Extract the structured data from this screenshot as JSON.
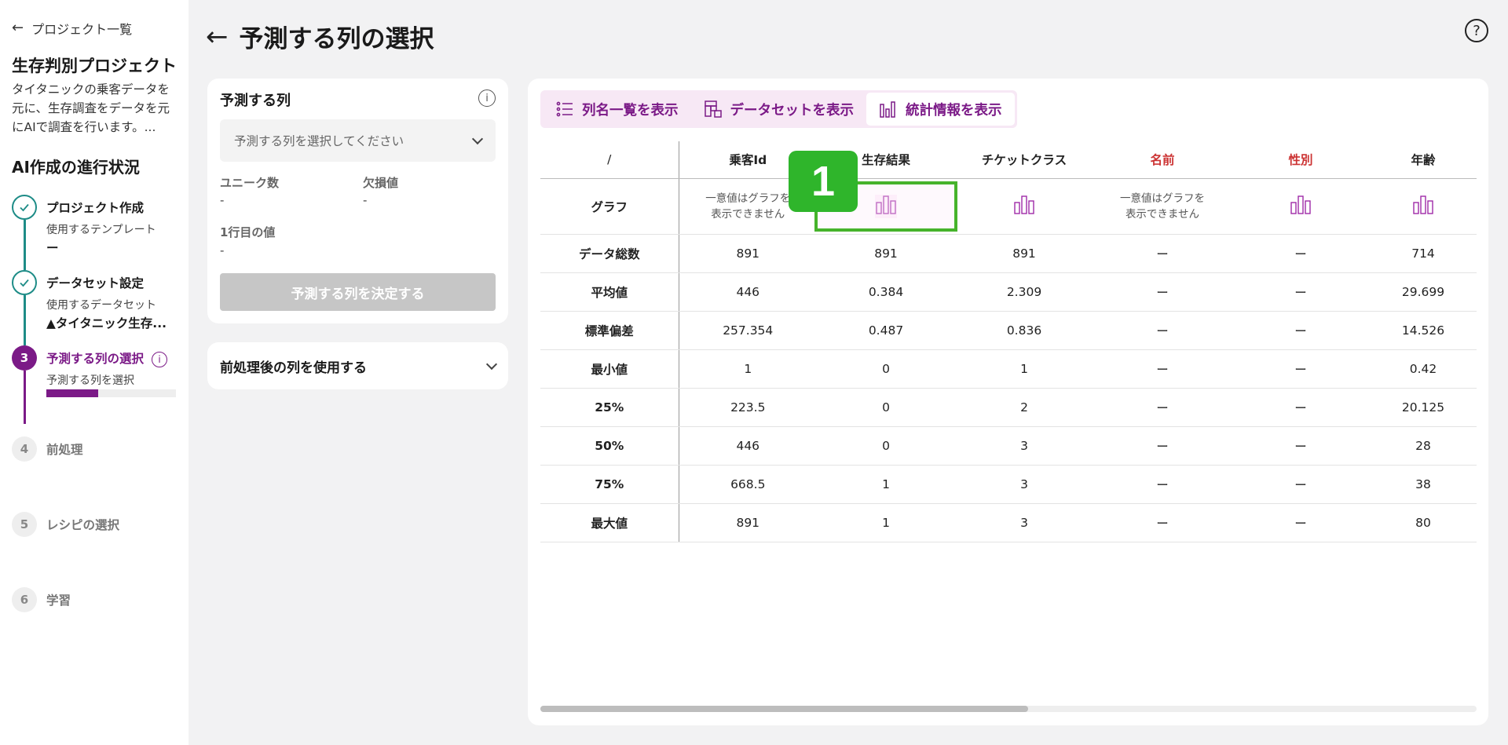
{
  "sidebar": {
    "back_link": "プロジェクト一覧",
    "project_title": "生存判別プロジェクト",
    "project_desc": "タイタニックの乗客データを元に、生存調査をデータを元にAIで調査を行います。...",
    "progress_title": "AI作成の進行状況",
    "steps": [
      {
        "num": "1",
        "label": "プロジェクト作成",
        "sub": "使用するテンプレート",
        "value": "ー",
        "status": "done"
      },
      {
        "num": "2",
        "label": "データセット設定",
        "sub": "使用するデータセット",
        "value": "▲タイタニック生存...",
        "status": "done"
      },
      {
        "num": "3",
        "label": "予測する列の選択",
        "sub": "予測する列を選択",
        "status": "active",
        "progress": 0.4
      },
      {
        "num": "4",
        "label": "前処理",
        "status": "pending"
      },
      {
        "num": "5",
        "label": "レシピの選択",
        "status": "pending"
      },
      {
        "num": "6",
        "label": "学習",
        "status": "pending"
      }
    ]
  },
  "header": {
    "title": "予測する列の選択",
    "help": "?"
  },
  "target_card": {
    "title": "予測する列",
    "info": "i",
    "select_placeholder": "予測する列を選択してください",
    "unique_label": "ユニーク数",
    "unique_value": "-",
    "missing_label": "欠損値",
    "missing_value": "-",
    "first_row_label": "1行目の値",
    "first_row_value": "-",
    "decide_button": "予測する列を決定する"
  },
  "prep_card": {
    "label": "前処理後の列を使用する"
  },
  "tabs": [
    {
      "label": "列名一覧を表示",
      "icon": "list-icon",
      "active": false
    },
    {
      "label": "データセットを表示",
      "icon": "dataset-icon",
      "active": false
    },
    {
      "label": "統計情報を表示",
      "icon": "bar-chart-icon",
      "active": true
    }
  ],
  "stats_table": {
    "corner": "/",
    "columns": [
      {
        "name": "乗客Id",
        "red": false,
        "graph": "none"
      },
      {
        "name": "生存結果",
        "red": false,
        "graph": "icon"
      },
      {
        "name": "チケットクラス",
        "red": false,
        "graph": "icon"
      },
      {
        "name": "名前",
        "red": true,
        "graph": "none"
      },
      {
        "name": "性別",
        "red": true,
        "graph": "icon"
      },
      {
        "name": "年齢",
        "red": false,
        "graph": "icon"
      }
    ],
    "graph_row_label": "グラフ",
    "no_graph_line1": "一意値はグラフを",
    "no_graph_line2": "表示できません",
    "rows": [
      {
        "label": "データ総数",
        "values": [
          "891",
          "891",
          "891",
          "ー",
          "ー",
          "714"
        ]
      },
      {
        "label": "平均値",
        "values": [
          "446",
          "0.384",
          "2.309",
          "ー",
          "ー",
          "29.699"
        ]
      },
      {
        "label": "標準偏差",
        "values": [
          "257.354",
          "0.487",
          "0.836",
          "ー",
          "ー",
          "14.526"
        ]
      },
      {
        "label": "最小値",
        "values": [
          "1",
          "0",
          "1",
          "ー",
          "ー",
          "0.42"
        ]
      },
      {
        "label": "25%",
        "values": [
          "223.5",
          "0",
          "2",
          "ー",
          "ー",
          "20.125"
        ]
      },
      {
        "label": "50%",
        "values": [
          "446",
          "0",
          "3",
          "ー",
          "ー",
          "28"
        ]
      },
      {
        "label": "75%",
        "values": [
          "668.5",
          "1",
          "3",
          "ー",
          "ー",
          "38"
        ]
      },
      {
        "label": "最大値",
        "values": [
          "891",
          "1",
          "3",
          "ー",
          "ー",
          "80"
        ]
      }
    ]
  },
  "annotation": {
    "badge": "1"
  },
  "colors": {
    "accent": "#7b1a87",
    "done": "#1e8c87",
    "highlight": "#46b32b",
    "warning_text": "#cc3333"
  }
}
